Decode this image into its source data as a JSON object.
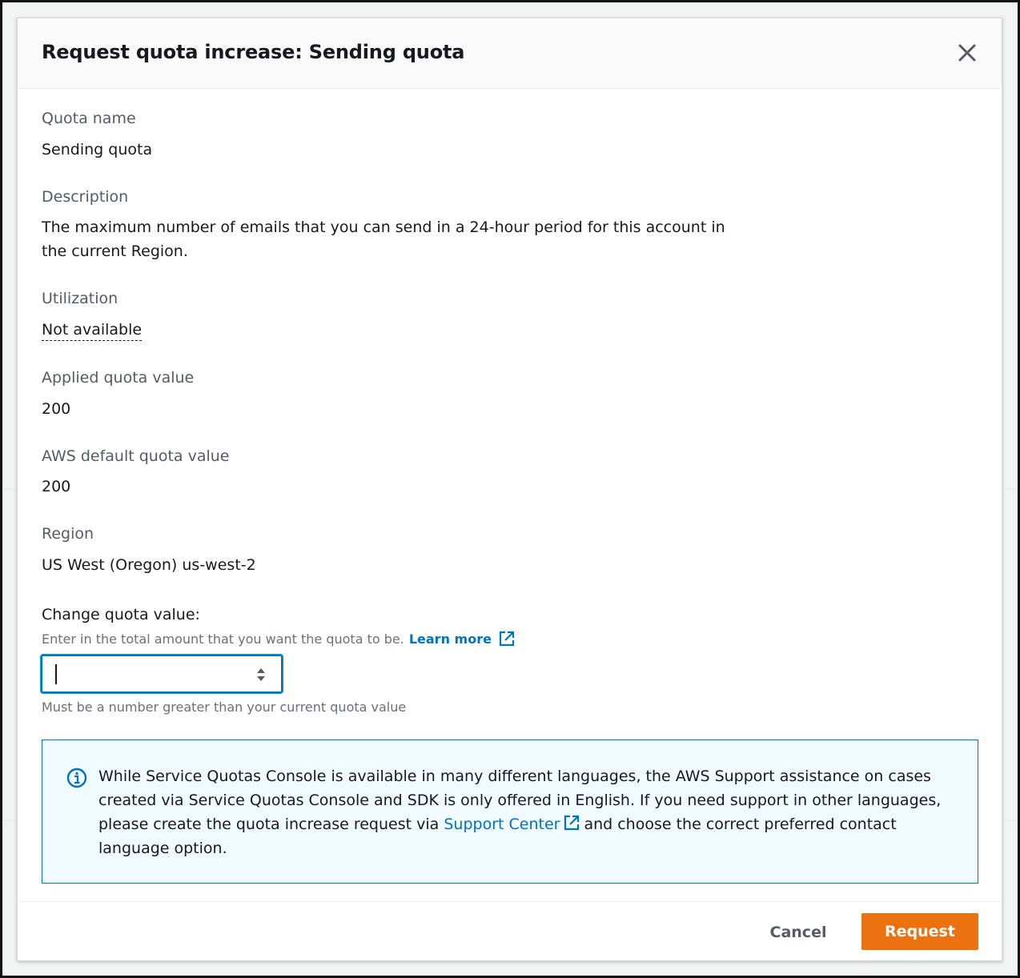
{
  "modal": {
    "title": "Request quota increase: Sending quota",
    "close_icon": "close-icon"
  },
  "fields": {
    "quota_name": {
      "label": "Quota name",
      "value": "Sending quota"
    },
    "description": {
      "label": "Description",
      "value": "The maximum number of emails that you can send in a 24-hour period for this account in the current Region."
    },
    "utilization": {
      "label": "Utilization",
      "value": "Not available"
    },
    "applied_quota": {
      "label": "Applied quota value",
      "value": "200"
    },
    "default_quota": {
      "label": "AWS default quota value",
      "value": "200"
    },
    "region": {
      "label": "Region",
      "value": "US West (Oregon) us-west-2"
    }
  },
  "change_quota": {
    "label": "Change quota value:",
    "hint": "Enter in the total amount that you want the quota to be.",
    "learn_more": "Learn more",
    "input_value": "",
    "constraint": "Must be a number greater than your current quota value",
    "external_icon": "external-link-icon",
    "stepper_icon": "stepper-icon"
  },
  "info_alert": {
    "icon": "info-icon",
    "text_before": "While Service Quotas Console is available in many different languages, the AWS Support assistance on cases created via Service Quotas Console and SDK is only offered in English. If you need support in other languages, please create the quota increase request via",
    "link": "Support Center",
    "text_after": "and choose the correct preferred contact language option."
  },
  "footer": {
    "cancel_label": "Cancel",
    "request_label": "Request"
  },
  "colors": {
    "primary": "#ec7211",
    "link": "#0073bb",
    "info_bg": "#f1faff"
  }
}
